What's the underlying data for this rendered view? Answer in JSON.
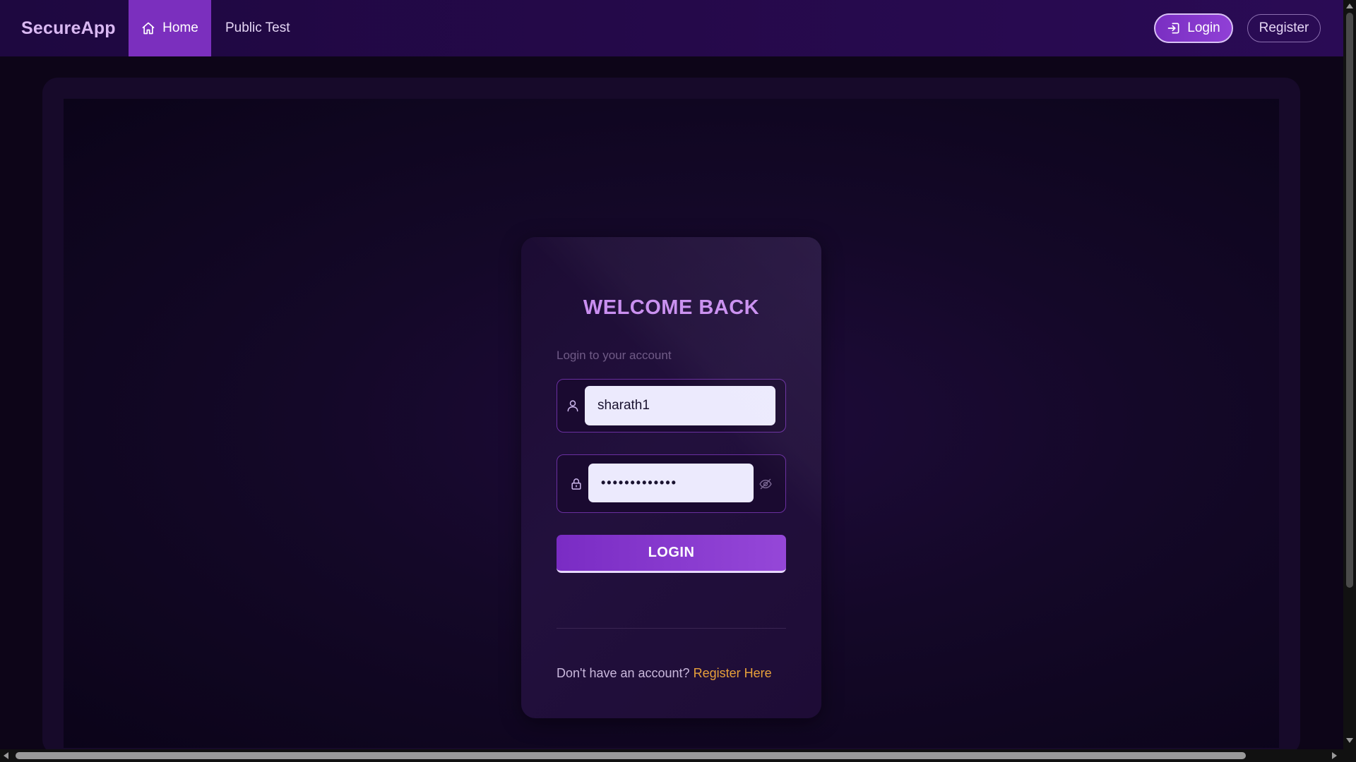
{
  "nav": {
    "brand": "SecureApp",
    "home_label": "Home",
    "public_test_label": "Public Test",
    "login_label": "Login",
    "register_label": "Register"
  },
  "login_card": {
    "title": "WELCOME BACK",
    "subtitle": "Login to your account",
    "username": {
      "icon": "user-icon",
      "value": "sharath1"
    },
    "password": {
      "icon": "lock-icon",
      "masked_value": "•••••••••••••",
      "toggle_icon": "eye-off-icon"
    },
    "submit_label": "LOGIN",
    "register_prompt": "Don't have an account?",
    "register_link": "Register Here"
  },
  "colors": {
    "accent": "#7b2fbe",
    "title": "#c98ef0",
    "link": "#e8a13a",
    "background": "#0d0518"
  }
}
